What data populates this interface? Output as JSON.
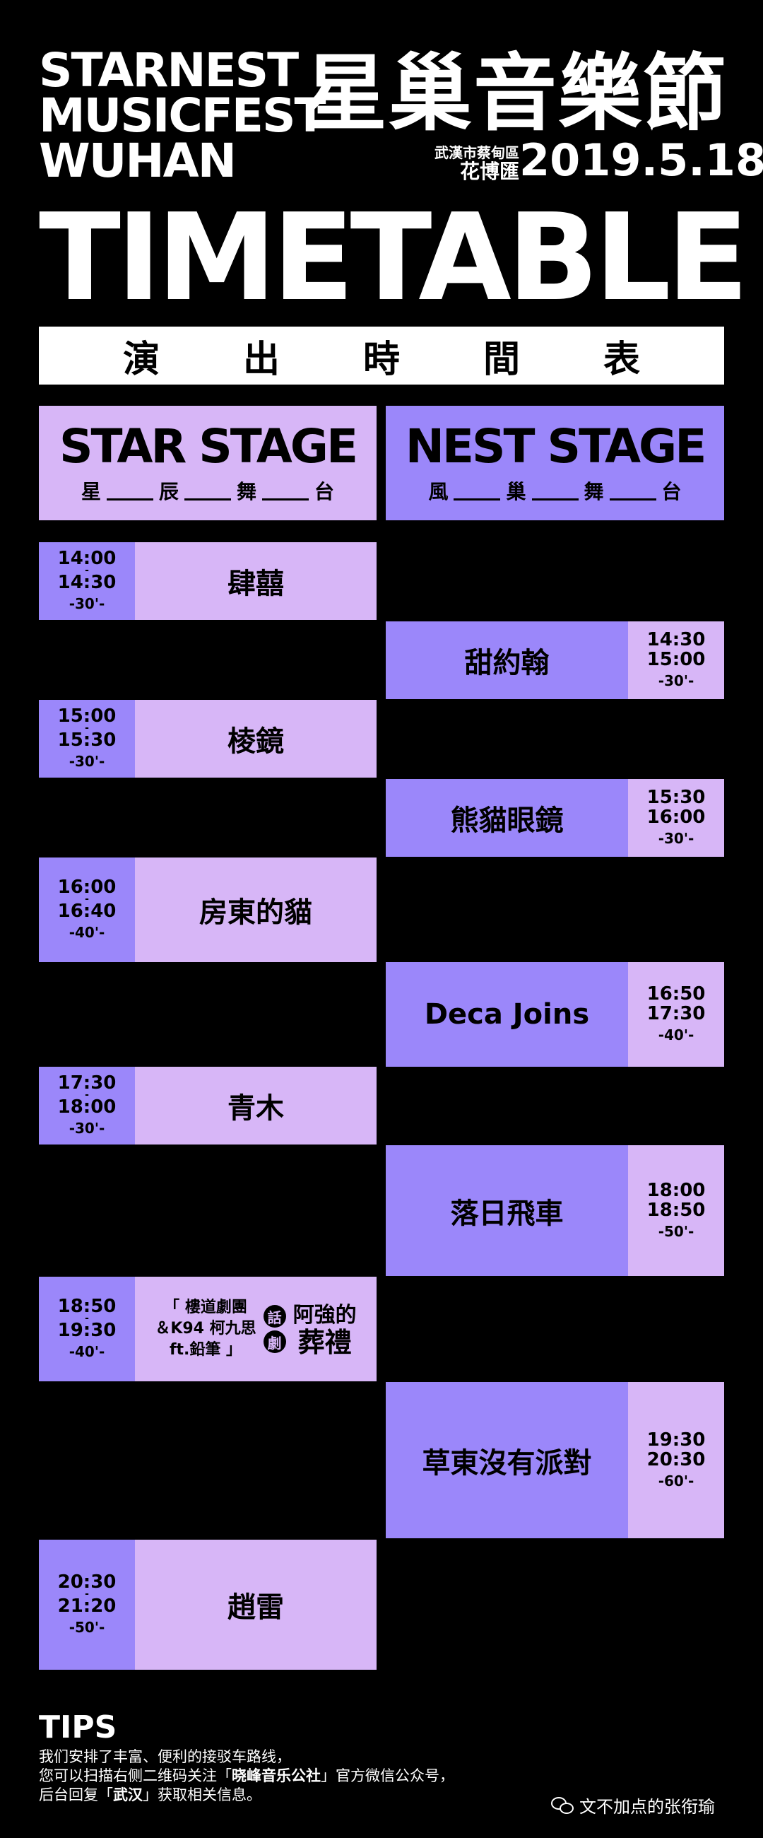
{
  "header": {
    "title_en_lines": [
      "STARNEST",
      "MUSICFEST",
      "WUHAN"
    ],
    "title_zh": "星巢音樂節",
    "venue_line1": "武漢市蔡甸區",
    "venue_line2": "花博匯",
    "date": "2019.5.18",
    "big_title": "TIMETABLE",
    "subtitle_zh": "演出時間表"
  },
  "stages": {
    "star": {
      "name": "STAR STAGE",
      "zh": [
        "星",
        "辰",
        "舞",
        "台"
      ],
      "color": "#d7b6f7"
    },
    "nest": {
      "name": "NEST STAGE",
      "zh": [
        "風",
        "巢",
        "舞",
        "台"
      ],
      "color": "#9b87fa"
    }
  },
  "star_slots": [
    {
      "start": "14:00",
      "end": "14:30",
      "duration": "-30'-",
      "act": "肆囍"
    },
    {
      "start": "15:00",
      "end": "15:30",
      "duration": "-30'-",
      "act": "棱鏡"
    },
    {
      "start": "16:00",
      "end": "16:40",
      "duration": "-40'-",
      "act": "房東的貓"
    },
    {
      "start": "17:30",
      "end": "18:00",
      "duration": "-30'-",
      "act": "青木"
    },
    {
      "start": "18:50",
      "end": "19:30",
      "duration": "-40'-",
      "act": "",
      "special": {
        "line1": "「 樓道劇團",
        "line2": "＆K94 柯九思",
        "line3": "ft.鉛筆 」",
        "badge1": "話",
        "badge2": "劇",
        "title1": "阿強的",
        "title2": "葬禮"
      }
    },
    {
      "start": "20:30",
      "end": "21:20",
      "duration": "-50'-",
      "act": "趙雷"
    }
  ],
  "nest_slots": [
    {
      "start": "14:30",
      "end": "15:00",
      "duration": "-30'-",
      "act": "甜約翰"
    },
    {
      "start": "15:30",
      "end": "16:00",
      "duration": "-30'-",
      "act": "熊貓眼鏡"
    },
    {
      "start": "16:50",
      "end": "17:30",
      "duration": "-40'-",
      "act": "Deca Joins"
    },
    {
      "start": "18:00",
      "end": "18:50",
      "duration": "-50'-",
      "act": "落日飛車"
    },
    {
      "start": "19:30",
      "end": "20:30",
      "duration": "-60'-",
      "act": "草東沒有派對"
    }
  ],
  "tips": {
    "title": "TIPS",
    "line1": "我们安排了丰富、便利的接驳车路线，",
    "line2_a": "您可以扫描右侧二维码关注「",
    "line2_b": "晓峰音乐公社",
    "line2_c": "」官方微信公众号，",
    "line3_a": "后台回复「",
    "line3_b": "武汉",
    "line3_c": "」获取相关信息。"
  },
  "watermark": {
    "icon": "wechat-icon",
    "text": "文不加点的张衔瑜"
  }
}
